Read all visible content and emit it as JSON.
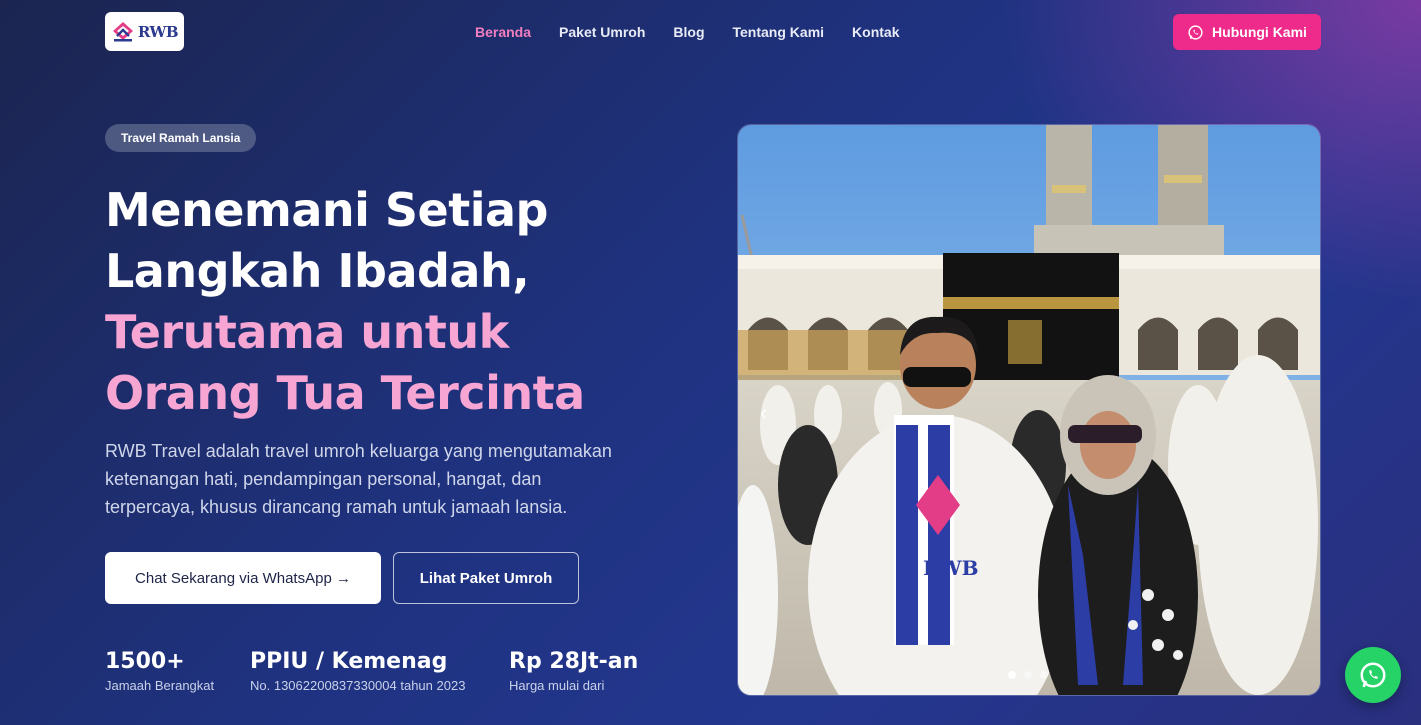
{
  "brand": {
    "logo_text": "RWB"
  },
  "nav": {
    "items": [
      {
        "label": "Beranda",
        "active": true
      },
      {
        "label": "Paket Umroh"
      },
      {
        "label": "Blog"
      },
      {
        "label": "Tentang Kami"
      },
      {
        "label": "Kontak"
      }
    ]
  },
  "header_cta": {
    "label": "Hubungi Kami",
    "icon": "whatsapp-icon"
  },
  "hero": {
    "badge": "Travel Ramah Lansia",
    "headline_white": "Menemani Setiap Langkah Ibadah,",
    "headline_pink": "Terutama untuk Orang Tua Tercinta",
    "description": "RWB Travel adalah travel umroh keluarga yang mengutamakan ketenangan hati, pendampingan personal, hangat, dan terpercaya, khusus dirancang ramah untuk jamaah lansia.",
    "primary_button": "Chat Sekarang via WhatsApp →",
    "secondary_button": "Lihat Paket Umroh",
    "stats": [
      {
        "value": "1500+",
        "label": "Jamaah Berangkat"
      },
      {
        "value": "PPIU / Kemenag",
        "label": "No. 13062200837330004 tahun 2023"
      },
      {
        "value": "Rp 28Jt-an",
        "label": "Harga mulai dari"
      }
    ]
  },
  "carousel": {
    "prev_icon": "chevron-left-icon",
    "slide_count": 3,
    "active_slide": 1,
    "scarf_text": "RWB"
  },
  "floating_whatsapp": {
    "icon": "whatsapp-icon"
  },
  "colors": {
    "accent_pink": "#ee2a8a",
    "headline_pink": "#f7a6d4",
    "nav_active": "#f27ec0",
    "whatsapp_green": "#25d366",
    "bg_navy": "#1f3280"
  }
}
